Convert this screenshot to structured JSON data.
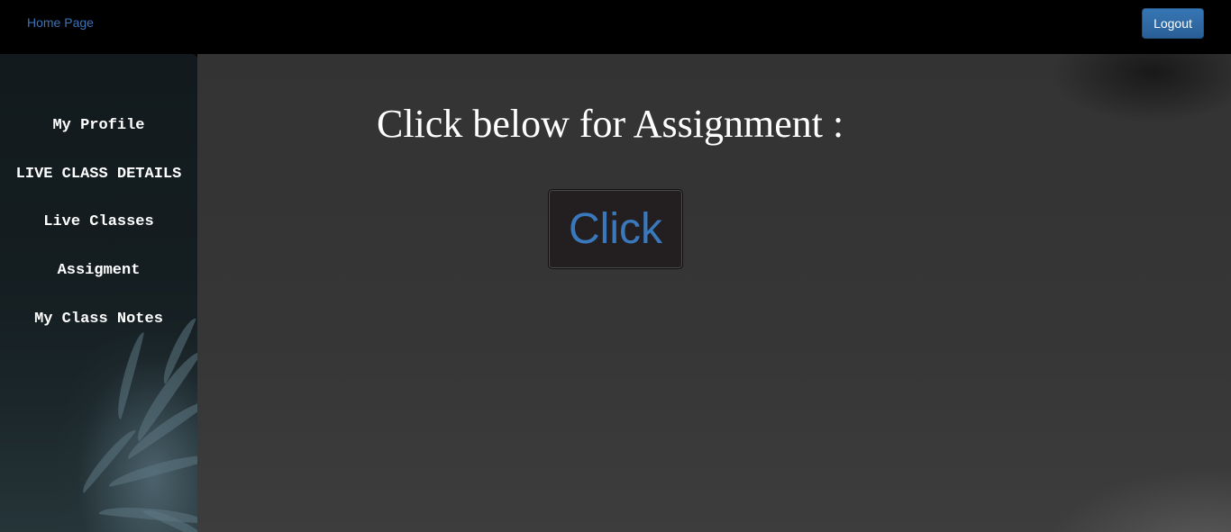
{
  "header": {
    "home_link": "Home Page",
    "logout_label": "Logout"
  },
  "sidebar": {
    "items": [
      {
        "label": "My Profile"
      },
      {
        "label": "LIVE CLASS DETAILS"
      },
      {
        "label": "Live Classes"
      },
      {
        "label": "Assigment"
      },
      {
        "label": "My Class Notes"
      }
    ]
  },
  "main": {
    "heading": "Click below for Assignment :",
    "click_label": "Click"
  },
  "colors": {
    "link": "#3a73b8",
    "logout_bg": "#2f6aa5",
    "click_text": "#3a78bc",
    "main_bg": "#353535"
  }
}
